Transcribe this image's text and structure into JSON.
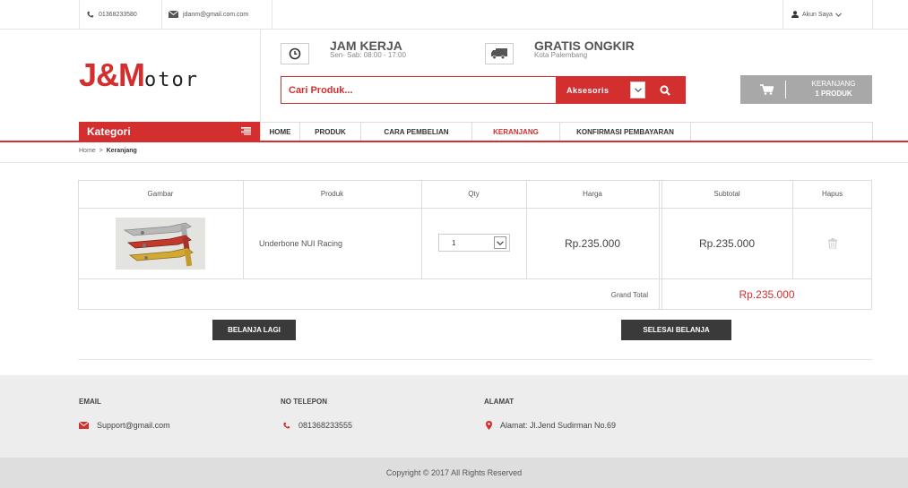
{
  "topbar": {
    "phone": "01368233580",
    "email": "jdanm@gmail.com.com",
    "account_label": "Akun Saya"
  },
  "logo": {
    "big": "J&M",
    "rest": "otor"
  },
  "header": {
    "hours_title": "JAM KERJA",
    "hours_sub": "Sen- Sab: 08:00 - 17:00",
    "shipping_title": "GRATIS ONGKIR",
    "shipping_sub": "Kota Palembang"
  },
  "search": {
    "placeholder": "Cari Produk...",
    "category": "Aksesoris"
  },
  "cart": {
    "label": "KERANJANG",
    "count": "1 PRODUK"
  },
  "nav": {
    "kategori": "Kategori",
    "items": [
      "HOME",
      "PRODUK",
      "CARA PEMBELIAN",
      "KERANJANG",
      "KONFIRMASI PEMBAYARAN"
    ]
  },
  "breadcrumb": {
    "home": "Home",
    "sep": ">",
    "current": "Keranjang"
  },
  "table": {
    "headers": [
      "Gambar",
      "Produk",
      "Qty",
      "Harga",
      "Subtotal",
      "Hapus"
    ],
    "rows": [
      {
        "product": "Underbone NUI Racing",
        "qty": "1",
        "price": "Rp.235.000",
        "subtotal": "Rp.235.000"
      }
    ],
    "grand_total_label": "Grand Total",
    "grand_total": "Rp.235.000"
  },
  "buttons": {
    "continue": "BELANJA LAGI",
    "finish": "SELESAI BELANJA"
  },
  "footer": {
    "email_head": "EMAIL",
    "email": "Support@gmail.com",
    "phone_head": "NO TELEPON",
    "phone": "081368233555",
    "address_head": "ALAMAT",
    "address": "Alamat: Jl.Jend Sudirman No.69",
    "copyright": "Copyright © 2017 All Rights Reserved"
  },
  "colors": {
    "accent": "#d32f2f",
    "dark_button": "#3a3a3a",
    "footer_bg": "#ededed"
  }
}
